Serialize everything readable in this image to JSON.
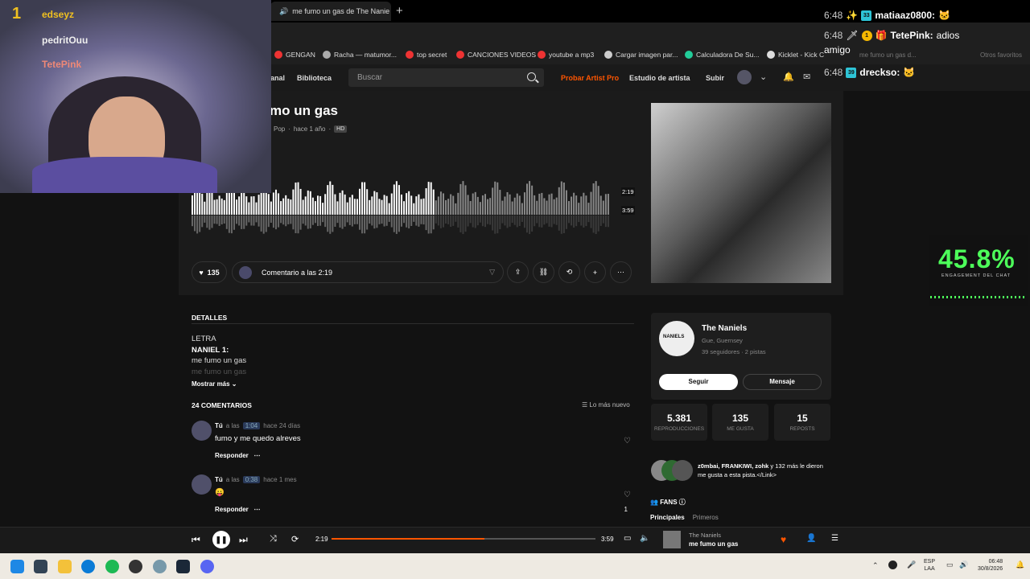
{
  "browser": {
    "tab_title": "me fumo un gas de The Nanie",
    "bookmarks": [
      "GENGAN",
      "Racha — matumor...",
      "top secret",
      "CANCIONES VIDEOS",
      "youtube a mp3",
      "Cargar imagen par...",
      "Calculadora De Su...",
      "Kicklet - Kick C"
    ],
    "other_favorites": "Otros favoritos",
    "ghost_tab_text": "me fumo un gas d..."
  },
  "navbar": {
    "links": [
      "anal",
      "Biblioteca"
    ],
    "search_placeholder": "Buscar",
    "artist_pro": "Probar Artist Pro",
    "studio": "Estudio de artista",
    "upload": "Subir"
  },
  "track": {
    "title": "mo un gas",
    "genre": "Pop",
    "sep": "·",
    "age": "hace 1 año",
    "hd": "HD",
    "played_time": "2:19",
    "total_time": "3:59",
    "likes": "135",
    "comment_placeholder": "Comentario a las 2:19",
    "progress": 0.58
  },
  "details": {
    "heading": "DETALLES",
    "lyrics": [
      "LETRA",
      "NANIEL 1:",
      "me fumo un gas",
      "me fumo un gas"
    ],
    "more": "Mostrar más"
  },
  "comments": {
    "heading": "24 COMENTARIOS",
    "sort": "Lo más nuevo",
    "items": [
      {
        "user": "Tú",
        "at": "a las",
        "ts": "1:04",
        "age": "hace 24 días",
        "text": "fumo y me quedo alreves",
        "reply": "Responder",
        "count": ""
      },
      {
        "user": "Tú",
        "at": "a las",
        "ts": "0:38",
        "age": "hace 1 mes",
        "text": "😛",
        "reply": "Responder",
        "count": "1"
      }
    ]
  },
  "artist": {
    "name": "The Naniels",
    "location": "Gue, Guernsey",
    "stats": "39 seguidores · 2 pistas",
    "follow": "Seguir",
    "message": "Mensaje",
    "avatar_text": "NANIELS"
  },
  "stats": [
    {
      "n": "5.381",
      "l": "REPRODUCCIONES"
    },
    {
      "n": "135",
      "l": "ME GUSTA"
    },
    {
      "n": "15",
      "l": "REPOSTS"
    }
  ],
  "likers": {
    "names": "z0mbai, FRANKIWI, zohk",
    "rest": " y 132 más le dieron me gusta a esta pista.</Link>"
  },
  "fans": {
    "heading": "FANS",
    "tabs": [
      "Principales",
      "Primeros"
    ]
  },
  "player": {
    "current": "2:19",
    "duration": "3:59",
    "artist": "The Naniels",
    "title": "me fumo un gas",
    "progress": 0.58
  },
  "taskbar": {
    "lang": "ESP",
    "layout": "LAA",
    "time": "06:48",
    "date": "30/8/2026"
  },
  "webcam": {
    "rank": "1",
    "names": [
      "edseyz",
      "pedritOuu",
      "TetePink"
    ]
  },
  "chat": [
    {
      "time": "6:48",
      "badge": "33",
      "user": "matiaaz0800:",
      "msg": ""
    },
    {
      "time": "6:48",
      "badge": "1",
      "user": "TetePink:",
      "msg": "adios"
    },
    {
      "time": "",
      "badge": "",
      "user": "",
      "msg": "amigo"
    },
    {
      "time": "6:48",
      "badge": "39",
      "user": "drecksо:",
      "msg": ""
    }
  ],
  "engagement": {
    "value": "45.8%",
    "label": "ENGAGEMENT DEL CHAT"
  },
  "colors": {
    "accent": "#ff5500",
    "green": "#4dff5a"
  }
}
